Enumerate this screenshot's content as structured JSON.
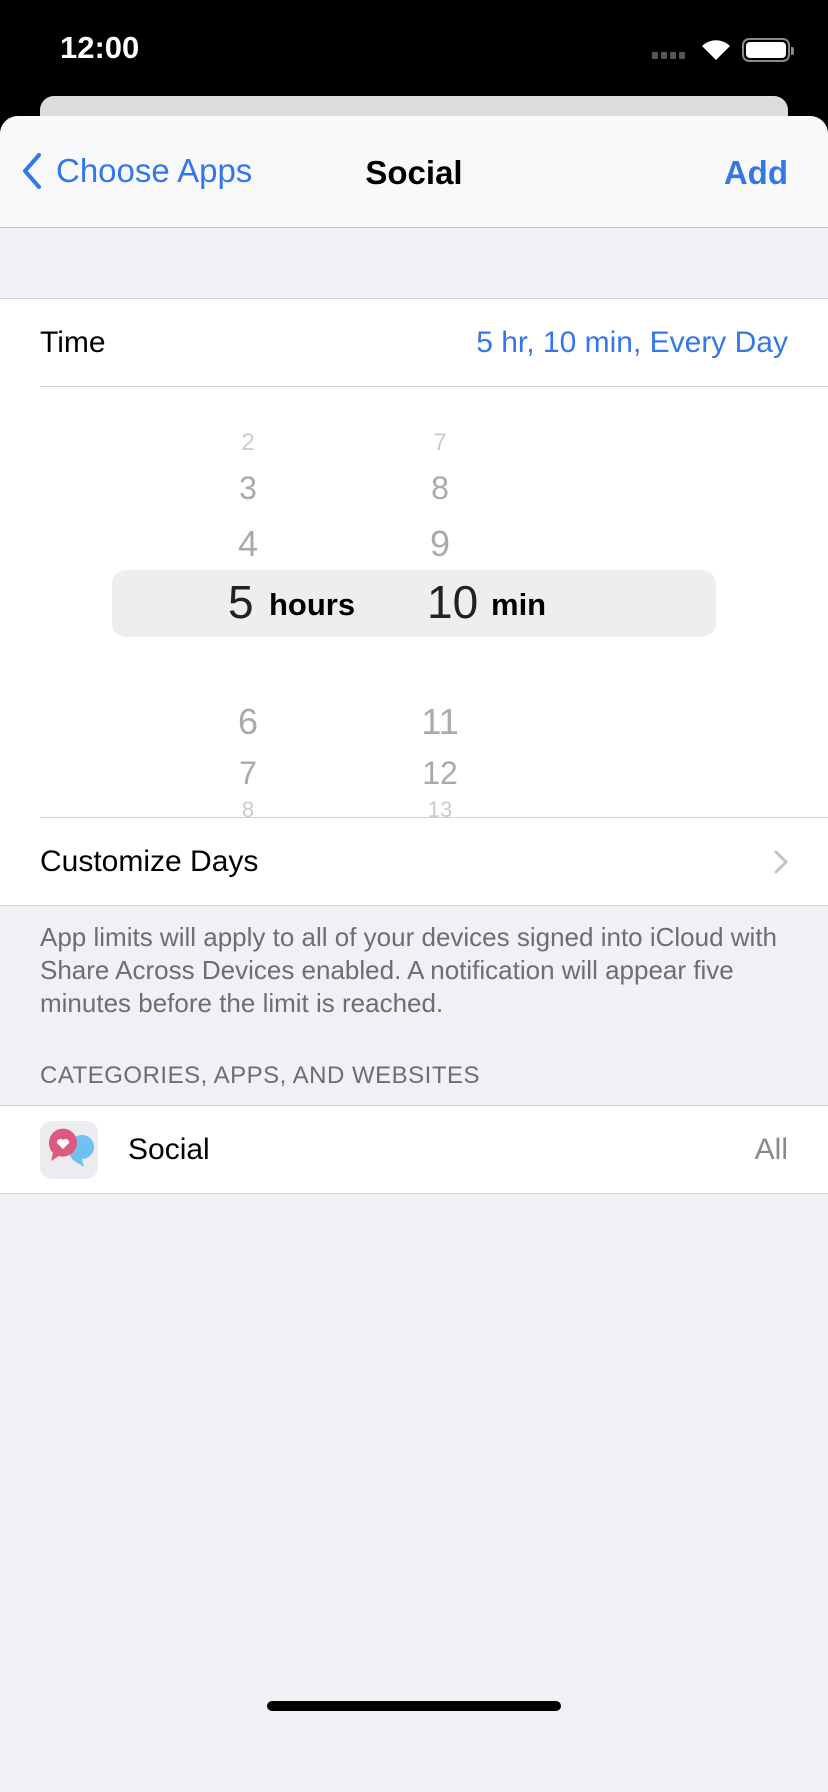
{
  "status_bar": {
    "time": "12:00"
  },
  "nav": {
    "back_label": "Choose Apps",
    "title": "Social",
    "add_label": "Add"
  },
  "time_row": {
    "label": "Time",
    "value": "5 hr, 10 min, Every Day"
  },
  "picker": {
    "hours": {
      "above": [
        "2",
        "3",
        "4"
      ],
      "selected": "5",
      "below": [
        "6",
        "7",
        "8"
      ],
      "unit": "hours"
    },
    "minutes": {
      "above": [
        "7",
        "8",
        "9"
      ],
      "selected": "10",
      "below": [
        "11",
        "12",
        "13"
      ],
      "unit": "min"
    }
  },
  "customize_days": {
    "label": "Customize Days"
  },
  "footer_text": "App limits will apply to all of your devices signed into iCloud with Share Across Devices enabled. A notification will appear five minutes before the limit is reached.",
  "section_header": "CATEGORIES, APPS, AND WEBSITES",
  "category_row": {
    "label": "Social",
    "value": "All",
    "icon": "social-bubbles-icon"
  },
  "colors": {
    "accent": "#3478e8",
    "icon_pink": "#dc5a80",
    "icon_blue": "#6fc1f0"
  }
}
